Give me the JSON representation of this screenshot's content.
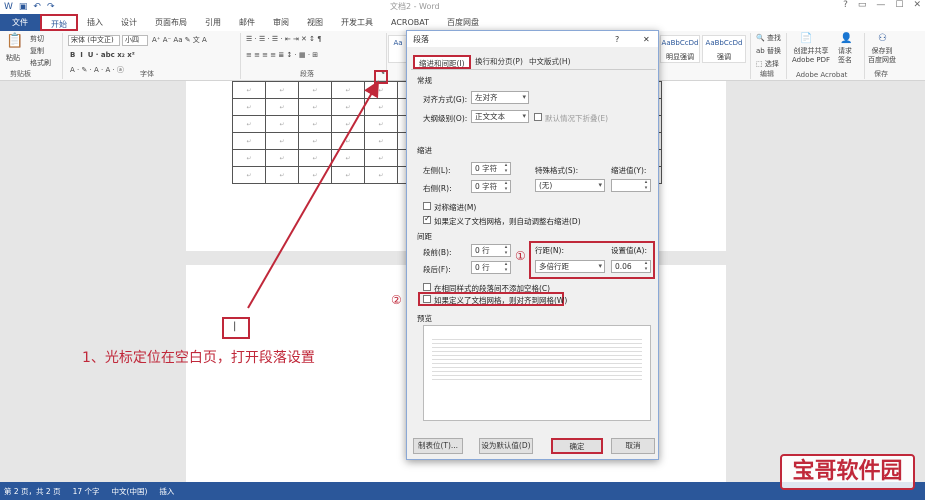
{
  "window": {
    "title": "文档2 - Word",
    "controls": [
      "?",
      "▭",
      "—",
      "☐",
      "✕"
    ]
  },
  "tabs": [
    "文件",
    "开始",
    "插入",
    "设计",
    "页面布局",
    "引用",
    "邮件",
    "审阅",
    "视图",
    "开发工具",
    "ACROBAT",
    "百度网盘"
  ],
  "ribbon": {
    "paste": "粘贴",
    "cut": "剪切",
    "copy": "复制",
    "format_painter": "格式刷",
    "clipboard_group": "剪贴板",
    "font_name": "宋体 (中文正)",
    "font_size": "小四",
    "font_group": "字体",
    "paragraph_group": "段落",
    "styles": [
      "AaBbCcDd",
      "AaBbCcDd",
      "AaBbCcDd"
    ],
    "style_names": [
      "",
      "明显强调",
      "强调"
    ],
    "find": "查找",
    "replace": "替换",
    "select": "选择",
    "edit_group": "编辑",
    "create_pdf": "创建并共享\nAdobe PDF",
    "create_pdf_l1": "创建并共享",
    "create_pdf_l2": "Adobe PDF",
    "request_sign_l1": "请求",
    "request_sign_l2": "签名",
    "acrobat_group": "Adobe Acrobat",
    "save_baidu_l1": "保存到",
    "save_baidu_l2": "百度网盘",
    "save_group": "保存"
  },
  "dialog": {
    "title": "段落",
    "help": "?",
    "close": "✕",
    "tabs": [
      "缩进和间距(I)",
      "换行和分页(P)",
      "中文版式(H)"
    ],
    "general_section": "常规",
    "alignment_label": "对齐方式(G):",
    "alignment_value": "左对齐",
    "outline_label": "大纲级别(O):",
    "outline_value": "正文文本",
    "collapse_label": "默认情况下折叠(E)",
    "indent_section": "缩进",
    "left_label": "左侧(L):",
    "left_value": "0 字符",
    "right_label": "右侧(R):",
    "right_value": "0 字符",
    "special_label": "特殊格式(S):",
    "special_value": "(无)",
    "indent_value_label": "缩进值(Y):",
    "mirror_label": "对称缩进(M)",
    "auto_adjust_label": "如果定义了文档网格，则自动调整右缩进(D)",
    "spacing_section": "间距",
    "before_label": "段前(B):",
    "before_value": "0 行",
    "after_label": "段后(F):",
    "after_value": "0 行",
    "line_spacing_label": "行距(N):",
    "line_spacing_value": "多倍行距",
    "set_value_label": "设置值(A):",
    "set_value": "0.06",
    "no_space_label": "在相同样式的段落间不添加空格(C)",
    "snap_grid_label": "如果定义了文档网格，则对齐到网格(W)",
    "preview_section": "预览",
    "tabs_button": "制表位(T)...",
    "default_button": "设为默认值(D)",
    "ok_button": "确定",
    "cancel_button": "取消"
  },
  "annotation": "1、光标定位在空白页，打开段落设置",
  "markers": [
    "①",
    "②"
  ],
  "statusbar": {
    "page": "第 2 页，共 2 页",
    "words": "17 个字",
    "lang": "中文(中国)",
    "mode": "插入"
  },
  "watermark": "宝哥软件园",
  "colors": {
    "accent": "#2b579a",
    "annotation": "#c0283a"
  }
}
